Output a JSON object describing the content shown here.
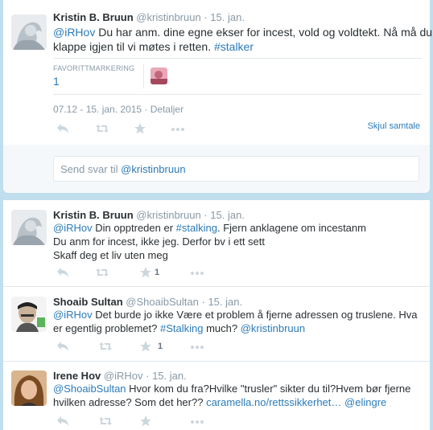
{
  "colors": {
    "link": "#2b7bb9",
    "muted": "#8899a6",
    "background": "#c0deed"
  },
  "expanded_tweet": {
    "fullname": "Kristin B. Bruun",
    "handle": "@kristinbruun",
    "dot": "·",
    "time": "15. jan.",
    "text_parts": {
      "mention": "@iRHov",
      "line1_rest": " Du har anm. dine egne ekser for incest, vold og voldtekt. Nå må du",
      "line2_start": "klappe igjen til vi møtes i retten. ",
      "hashtag": "#stalker"
    },
    "favorites_label": "FAVORITTMARKERING",
    "favorites_count": "1",
    "meta_text": "07.12 - 15. jan. 2015 · Detaljer",
    "collapse_label": "Skjul samtale",
    "icons": {
      "reply": "reply-icon",
      "retweet": "retweet-icon",
      "favorite": "star-icon",
      "more": "more-icon"
    }
  },
  "reply_box": {
    "prefix": "Send svar til ",
    "mention": "@kristinbruun"
  },
  "tweets": [
    {
      "fullname": "Kristin B. Bruun",
      "handle": "@kristinbruun",
      "time": "15. jan.",
      "mention": "@iRHov",
      "l1a": " Din opptreden er ",
      "hashtag": "#stalking",
      "l1b": ". Fjern anklagene om incestanm",
      "l2": "Du anm for incest,  ikke jeg. Derfor bv i ett sett",
      "l3": "Skaff deg et liv uten meg",
      "fav_count": "1"
    },
    {
      "fullname": "Shoaib Sultan",
      "handle": "@ShoaibSultan",
      "time": "15. jan.",
      "mention": "@iRHov",
      "l1a": " Det burde jo ikke Være et problem å fjerne adressen og truslene. Hva",
      "l2a": "er egentlig problemet? ",
      "hashtag": "#Stalking",
      "l2b": " much? ",
      "mention2": "@kristinbruun",
      "fav_count": "1"
    },
    {
      "fullname": "Irene Hov",
      "handle": "@iRHov",
      "time": "15. jan.",
      "mention": "@ShoaibSultan",
      "l1a": " Hvor kom du fra?Hvilke \"trusler\" sikter du til?Hvem bør fjerne",
      "l2a": "hvilken adresse? Som det her?? ",
      "link": "caramella.no/rettssikkerhet…",
      "mention2": "@elingre"
    }
  ]
}
